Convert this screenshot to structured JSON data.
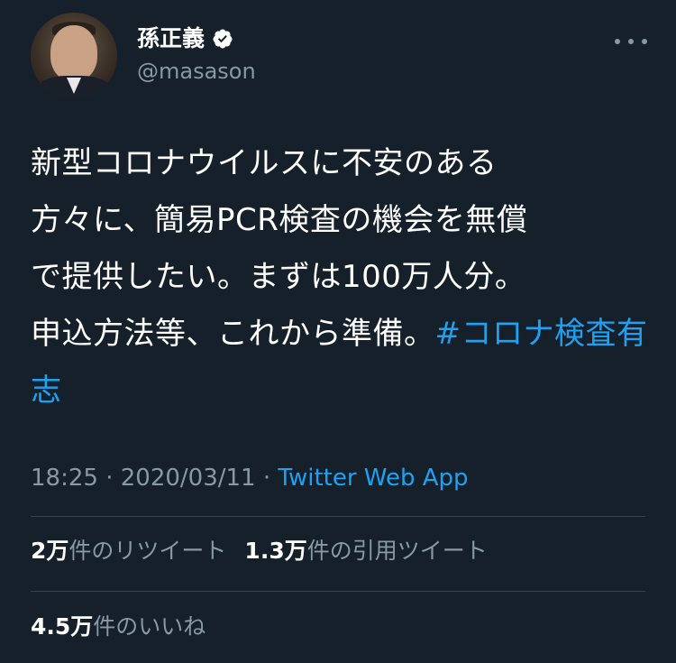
{
  "user": {
    "display_name": "孫正義",
    "handle": "@masason",
    "verified_icon": "verified-badge-icon",
    "avatar": "profile-photo"
  },
  "tweet": {
    "text": "新型コロナウイルスに不安のある\n方々に、簡易PCR検査の機会を無償\nで提供したい。まずは100万人分。\n申込方法等、これから準備。",
    "hashtag": "#コロナ検査有志"
  },
  "meta": {
    "time": "18:25",
    "separator": " · ",
    "date": "2020/03/11",
    "source": "Twitter Web App"
  },
  "stats": {
    "retweets_count": "2万",
    "retweets_label": "件のリツイート",
    "quotes_count": "1.3万",
    "quotes_label": "件の引用ツイート",
    "likes_count": "4.5万",
    "likes_label": "件のいいね"
  },
  "colors": {
    "background": "#15202b",
    "accent": "#1da1f2",
    "secondary_text": "#8899a6",
    "divider": "#38444d"
  }
}
